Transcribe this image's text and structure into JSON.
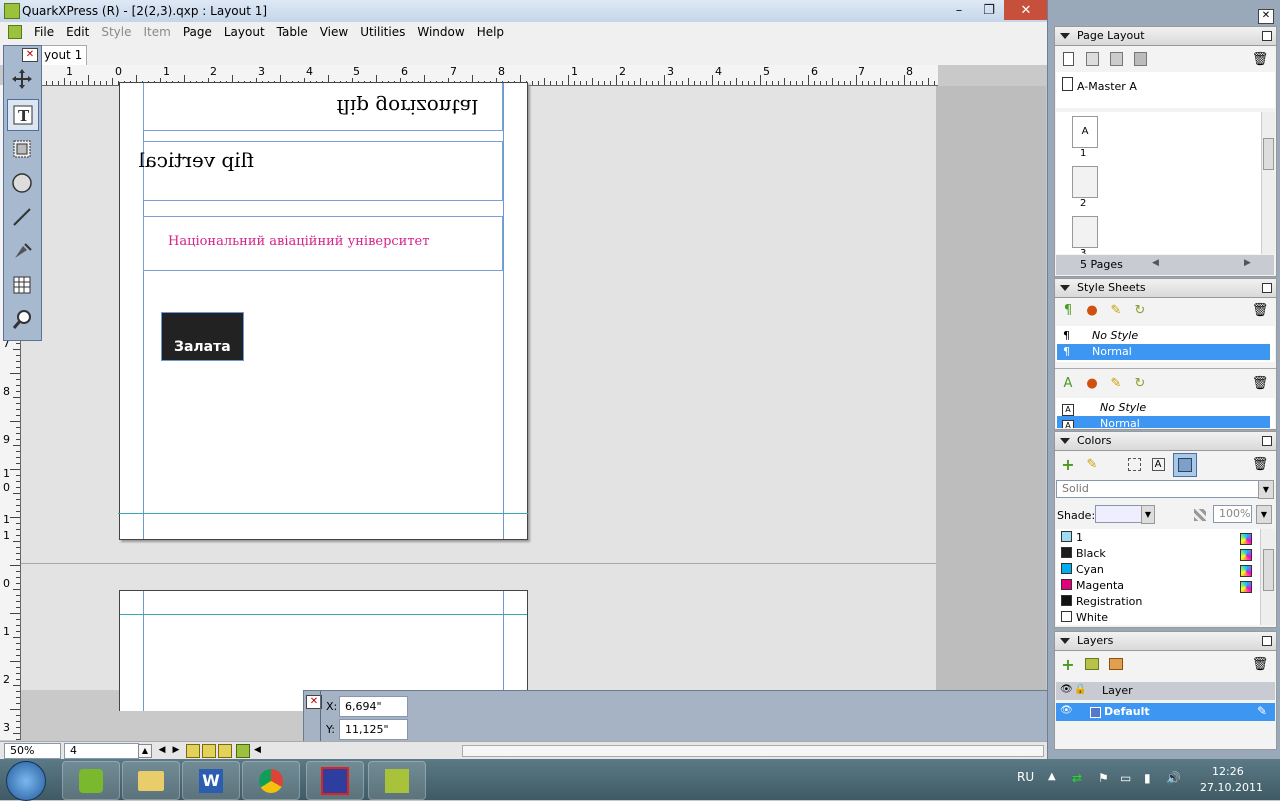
{
  "window": {
    "title": "QuarkXPress (R) - [2(2,3).qxp : Layout 1]",
    "minimize": "–",
    "maximize": "❐",
    "close": "✕"
  },
  "menu": [
    "File",
    "Edit",
    "Style",
    "Item",
    "Page",
    "Layout",
    "Table",
    "View",
    "Utilities",
    "Window",
    "Help"
  ],
  "menu_disabled": [
    "Style",
    "Item"
  ],
  "layout_tab": "yout 1",
  "ruler_h_labels": [
    "1",
    "0",
    "1",
    "2",
    "3",
    "4",
    "5",
    "6",
    "7",
    "8",
    "1",
    "2",
    "3",
    "4",
    "5",
    "6",
    "7",
    "8"
  ],
  "ruler_v_labels": [
    "7",
    "8",
    "9",
    "1",
    "0",
    "1",
    "1",
    "0",
    "1",
    "2",
    "3"
  ],
  "page": {
    "text_flip_horizontal": "flip gorizontal",
    "text_flip_vertical": "flip vertical",
    "text_university": "Національний авіаційний університет",
    "text_button": "Залата",
    "university_color": "#d6228a"
  },
  "measurements": {
    "x_label": "X:",
    "x_value": "6,694\"",
    "y_label": "Y:",
    "y_value": "11,125\""
  },
  "statusbar": {
    "zoom": "50%",
    "page": "4"
  },
  "palettes": {
    "page_layout": {
      "title": "Page Layout",
      "master": "A-Master A",
      "pages": [
        {
          "label": "A",
          "num": "1"
        },
        {
          "label": "",
          "num": "2"
        },
        {
          "label": "",
          "num": "3"
        }
      ],
      "page_count": "5 Pages"
    },
    "style_sheets": {
      "title": "Style Sheets",
      "paragraph": [
        "No Style",
        "Normal"
      ],
      "character": [
        "No Style",
        "Normal"
      ]
    },
    "colors": {
      "title": "Colors",
      "fill_type": "Solid",
      "shade_label": "Shade:",
      "shade_value": "",
      "opacity": "100%",
      "items": [
        {
          "name": "1",
          "color": "#9fdcf2"
        },
        {
          "name": "Black",
          "color": "#1a1a1a"
        },
        {
          "name": "Cyan",
          "color": "#00aeef"
        },
        {
          "name": "Magenta",
          "color": "#e4007c"
        },
        {
          "name": "Registration",
          "color": "#111111"
        },
        {
          "name": "White",
          "color": "#ffffff"
        }
      ]
    },
    "layers": {
      "title": "Layers",
      "header": "Layer",
      "items": [
        "Default"
      ]
    }
  },
  "taskbar": {
    "lang": "RU",
    "time": "12:26",
    "date": "27.10.2011",
    "apps": [
      "start-orb",
      "green-app",
      "folder",
      "word",
      "chrome",
      "save",
      "quark"
    ]
  }
}
